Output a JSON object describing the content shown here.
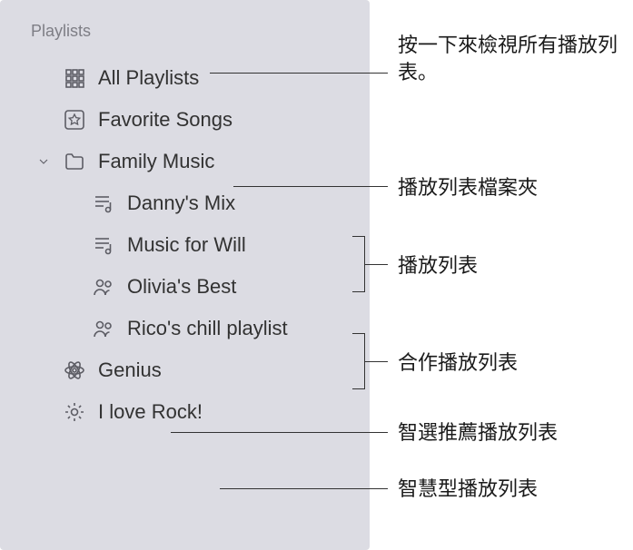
{
  "sidebar": {
    "section_header": "Playlists",
    "items": [
      {
        "label": "All Playlists"
      },
      {
        "label": "Favorite Songs"
      },
      {
        "label": "Family Music"
      },
      {
        "label": "Danny's Mix"
      },
      {
        "label": "Music for Will"
      },
      {
        "label": "Olivia's Best"
      },
      {
        "label": "Rico's chill playlist"
      },
      {
        "label": "Genius"
      },
      {
        "label": "I love Rock!"
      }
    ]
  },
  "annotations": {
    "all_playlists": "按一下來檢視所有播放列表。",
    "folder": "播放列表檔案夾",
    "playlist": "播放列表",
    "collaborative": "合作播放列表",
    "genius": "智選推薦播放列表",
    "smart": "智慧型播放列表"
  }
}
